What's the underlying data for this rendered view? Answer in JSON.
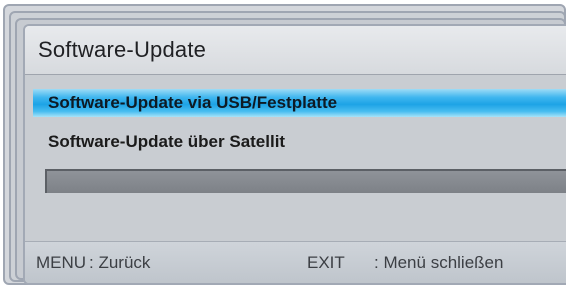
{
  "window": {
    "title": "Software-Update"
  },
  "menu": {
    "items": [
      {
        "label": "Software-Update via USB/Festplatte",
        "selected": true
      },
      {
        "label": "Software-Update über Satellit",
        "selected": false
      }
    ]
  },
  "progress": {
    "value": 0
  },
  "footer": {
    "menu_key": "MENU",
    "menu_action": ": Zurück",
    "exit_key": "EXIT",
    "exit_action": ": Menü schließen"
  },
  "colors": {
    "highlight": "#1da3e6",
    "panel": "#c9cdd2",
    "progress_track": "#888c92"
  }
}
